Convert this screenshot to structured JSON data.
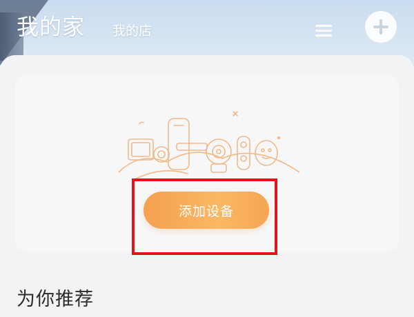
{
  "header": {
    "home_title": "我的家",
    "shop_tab": "我的店",
    "menu_icon": "menu-icon",
    "add_icon": "add-circle-icon"
  },
  "empty_state": {
    "illustration": "smart-devices-illustration",
    "add_device_label": "添加设备"
  },
  "section": {
    "recommend_title": "为你推荐"
  },
  "colors": {
    "button_orange": "#f5a04f",
    "highlight_red": "#e3151a",
    "line_orange": "#f0b98a"
  }
}
